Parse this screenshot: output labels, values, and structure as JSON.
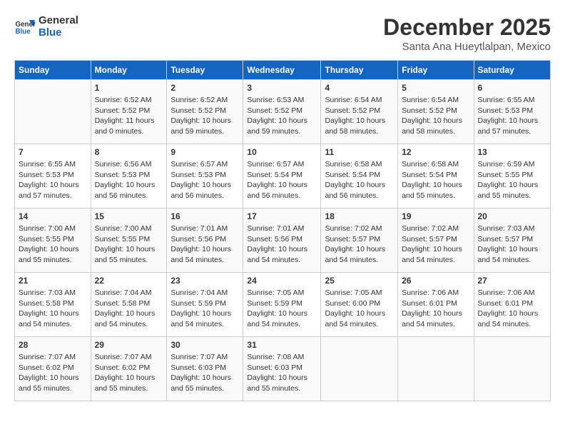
{
  "header": {
    "logo_line1": "General",
    "logo_line2": "Blue",
    "month_title": "December 2025",
    "location": "Santa Ana Hueytlalpan, Mexico"
  },
  "weekdays": [
    "Sunday",
    "Monday",
    "Tuesday",
    "Wednesday",
    "Thursday",
    "Friday",
    "Saturday"
  ],
  "weeks": [
    [
      {
        "day": "",
        "info": ""
      },
      {
        "day": "1",
        "info": "Sunrise: 6:52 AM\nSunset: 5:52 PM\nDaylight: 11 hours\nand 0 minutes."
      },
      {
        "day": "2",
        "info": "Sunrise: 6:52 AM\nSunset: 5:52 PM\nDaylight: 10 hours\nand 59 minutes."
      },
      {
        "day": "3",
        "info": "Sunrise: 6:53 AM\nSunset: 5:52 PM\nDaylight: 10 hours\nand 59 minutes."
      },
      {
        "day": "4",
        "info": "Sunrise: 6:54 AM\nSunset: 5:52 PM\nDaylight: 10 hours\nand 58 minutes."
      },
      {
        "day": "5",
        "info": "Sunrise: 6:54 AM\nSunset: 5:52 PM\nDaylight: 10 hours\nand 58 minutes."
      },
      {
        "day": "6",
        "info": "Sunrise: 6:55 AM\nSunset: 5:53 PM\nDaylight: 10 hours\nand 57 minutes."
      }
    ],
    [
      {
        "day": "7",
        "info": "Sunrise: 6:55 AM\nSunset: 5:53 PM\nDaylight: 10 hours\nand 57 minutes."
      },
      {
        "day": "8",
        "info": "Sunrise: 6:56 AM\nSunset: 5:53 PM\nDaylight: 10 hours\nand 56 minutes."
      },
      {
        "day": "9",
        "info": "Sunrise: 6:57 AM\nSunset: 5:53 PM\nDaylight: 10 hours\nand 56 minutes."
      },
      {
        "day": "10",
        "info": "Sunrise: 6:57 AM\nSunset: 5:54 PM\nDaylight: 10 hours\nand 56 minutes."
      },
      {
        "day": "11",
        "info": "Sunrise: 6:58 AM\nSunset: 5:54 PM\nDaylight: 10 hours\nand 56 minutes."
      },
      {
        "day": "12",
        "info": "Sunrise: 6:58 AM\nSunset: 5:54 PM\nDaylight: 10 hours\nand 55 minutes."
      },
      {
        "day": "13",
        "info": "Sunrise: 6:59 AM\nSunset: 5:55 PM\nDaylight: 10 hours\nand 55 minutes."
      }
    ],
    [
      {
        "day": "14",
        "info": "Sunrise: 7:00 AM\nSunset: 5:55 PM\nDaylight: 10 hours\nand 55 minutes."
      },
      {
        "day": "15",
        "info": "Sunrise: 7:00 AM\nSunset: 5:55 PM\nDaylight: 10 hours\nand 55 minutes."
      },
      {
        "day": "16",
        "info": "Sunrise: 7:01 AM\nSunset: 5:56 PM\nDaylight: 10 hours\nand 54 minutes."
      },
      {
        "day": "17",
        "info": "Sunrise: 7:01 AM\nSunset: 5:56 PM\nDaylight: 10 hours\nand 54 minutes."
      },
      {
        "day": "18",
        "info": "Sunrise: 7:02 AM\nSunset: 5:57 PM\nDaylight: 10 hours\nand 54 minutes."
      },
      {
        "day": "19",
        "info": "Sunrise: 7:02 AM\nSunset: 5:57 PM\nDaylight: 10 hours\nand 54 minutes."
      },
      {
        "day": "20",
        "info": "Sunrise: 7:03 AM\nSunset: 5:57 PM\nDaylight: 10 hours\nand 54 minutes."
      }
    ],
    [
      {
        "day": "21",
        "info": "Sunrise: 7:03 AM\nSunset: 5:58 PM\nDaylight: 10 hours\nand 54 minutes."
      },
      {
        "day": "22",
        "info": "Sunrise: 7:04 AM\nSunset: 5:58 PM\nDaylight: 10 hours\nand 54 minutes."
      },
      {
        "day": "23",
        "info": "Sunrise: 7:04 AM\nSunset: 5:59 PM\nDaylight: 10 hours\nand 54 minutes."
      },
      {
        "day": "24",
        "info": "Sunrise: 7:05 AM\nSunset: 5:59 PM\nDaylight: 10 hours\nand 54 minutes."
      },
      {
        "day": "25",
        "info": "Sunrise: 7:05 AM\nSunset: 6:00 PM\nDaylight: 10 hours\nand 54 minutes."
      },
      {
        "day": "26",
        "info": "Sunrise: 7:06 AM\nSunset: 6:01 PM\nDaylight: 10 hours\nand 54 minutes."
      },
      {
        "day": "27",
        "info": "Sunrise: 7:06 AM\nSunset: 6:01 PM\nDaylight: 10 hours\nand 54 minutes."
      }
    ],
    [
      {
        "day": "28",
        "info": "Sunrise: 7:07 AM\nSunset: 6:02 PM\nDaylight: 10 hours\nand 55 minutes."
      },
      {
        "day": "29",
        "info": "Sunrise: 7:07 AM\nSunset: 6:02 PM\nDaylight: 10 hours\nand 55 minutes."
      },
      {
        "day": "30",
        "info": "Sunrise: 7:07 AM\nSunset: 6:03 PM\nDaylight: 10 hours\nand 55 minutes."
      },
      {
        "day": "31",
        "info": "Sunrise: 7:08 AM\nSunset: 6:03 PM\nDaylight: 10 hours\nand 55 minutes."
      },
      {
        "day": "",
        "info": ""
      },
      {
        "day": "",
        "info": ""
      },
      {
        "day": "",
        "info": ""
      }
    ]
  ]
}
